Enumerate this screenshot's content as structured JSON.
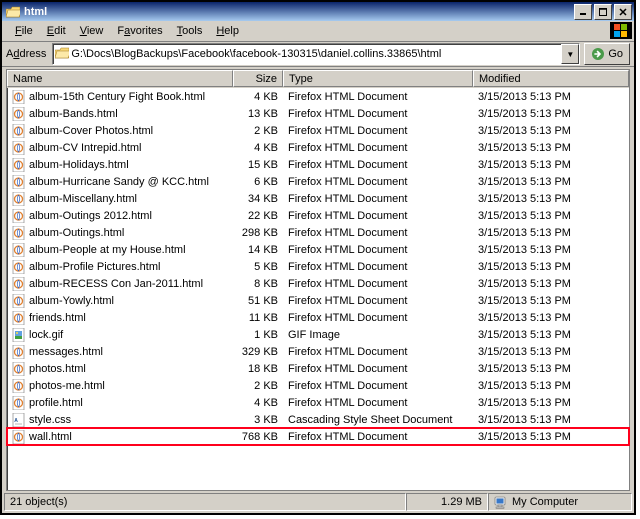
{
  "window": {
    "title": "html"
  },
  "menu": {
    "file": "File",
    "edit": "Edit",
    "view": "View",
    "favorites": "Favorites",
    "tools": "Tools",
    "help": "Help"
  },
  "address": {
    "label": "Address",
    "path": "G:\\Docs\\BlogBackups\\Facebook\\facebook-130315\\daniel.collins.33865\\html",
    "go": "Go"
  },
  "columns": {
    "name": "Name",
    "size": "Size",
    "type": "Type",
    "modified": "Modified"
  },
  "types": {
    "html": "Firefox HTML Document",
    "gif": "GIF Image",
    "css": "Cascading Style Sheet Document"
  },
  "files": [
    {
      "name": "album-15th Century Fight Book.html",
      "size": "4 KB",
      "type": "html",
      "modified": "3/15/2013 5:13 PM",
      "icon": "html"
    },
    {
      "name": "album-Bands.html",
      "size": "13 KB",
      "type": "html",
      "modified": "3/15/2013 5:13 PM",
      "icon": "html"
    },
    {
      "name": "album-Cover Photos.html",
      "size": "2 KB",
      "type": "html",
      "modified": "3/15/2013 5:13 PM",
      "icon": "html"
    },
    {
      "name": "album-CV Intrepid.html",
      "size": "4 KB",
      "type": "html",
      "modified": "3/15/2013 5:13 PM",
      "icon": "html"
    },
    {
      "name": "album-Holidays.html",
      "size": "15 KB",
      "type": "html",
      "modified": "3/15/2013 5:13 PM",
      "icon": "html"
    },
    {
      "name": "album-Hurricane Sandy @ KCC.html",
      "size": "6 KB",
      "type": "html",
      "modified": "3/15/2013 5:13 PM",
      "icon": "html"
    },
    {
      "name": "album-Miscellany.html",
      "size": "34 KB",
      "type": "html",
      "modified": "3/15/2013 5:13 PM",
      "icon": "html"
    },
    {
      "name": "album-Outings 2012.html",
      "size": "22 KB",
      "type": "html",
      "modified": "3/15/2013 5:13 PM",
      "icon": "html"
    },
    {
      "name": "album-Outings.html",
      "size": "298 KB",
      "type": "html",
      "modified": "3/15/2013 5:13 PM",
      "icon": "html"
    },
    {
      "name": "album-People at my House.html",
      "size": "14 KB",
      "type": "html",
      "modified": "3/15/2013 5:13 PM",
      "icon": "html"
    },
    {
      "name": "album-Profile Pictures.html",
      "size": "5 KB",
      "type": "html",
      "modified": "3/15/2013 5:13 PM",
      "icon": "html"
    },
    {
      "name": "album-RECESS Con Jan-2011.html",
      "size": "8 KB",
      "type": "html",
      "modified": "3/15/2013 5:13 PM",
      "icon": "html"
    },
    {
      "name": "album-Yowly.html",
      "size": "51 KB",
      "type": "html",
      "modified": "3/15/2013 5:13 PM",
      "icon": "html"
    },
    {
      "name": "friends.html",
      "size": "11 KB",
      "type": "html",
      "modified": "3/15/2013 5:13 PM",
      "icon": "html"
    },
    {
      "name": "lock.gif",
      "size": "1 KB",
      "type": "gif",
      "modified": "3/15/2013 5:13 PM",
      "icon": "gif"
    },
    {
      "name": "messages.html",
      "size": "329 KB",
      "type": "html",
      "modified": "3/15/2013 5:13 PM",
      "icon": "html"
    },
    {
      "name": "photos.html",
      "size": "18 KB",
      "type": "html",
      "modified": "3/15/2013 5:13 PM",
      "icon": "html"
    },
    {
      "name": "photos-me.html",
      "size": "2 KB",
      "type": "html",
      "modified": "3/15/2013 5:13 PM",
      "icon": "html"
    },
    {
      "name": "profile.html",
      "size": "4 KB",
      "type": "html",
      "modified": "3/15/2013 5:13 PM",
      "icon": "html"
    },
    {
      "name": "style.css",
      "size": "3 KB",
      "type": "css",
      "modified": "3/15/2013 5:13 PM",
      "icon": "css"
    },
    {
      "name": "wall.html",
      "size": "768 KB",
      "type": "html",
      "modified": "3/15/2013 5:13 PM",
      "icon": "html",
      "highlight": true
    }
  ],
  "status": {
    "objects": "21 object(s)",
    "size": "1.29 MB",
    "location": "My Computer"
  }
}
